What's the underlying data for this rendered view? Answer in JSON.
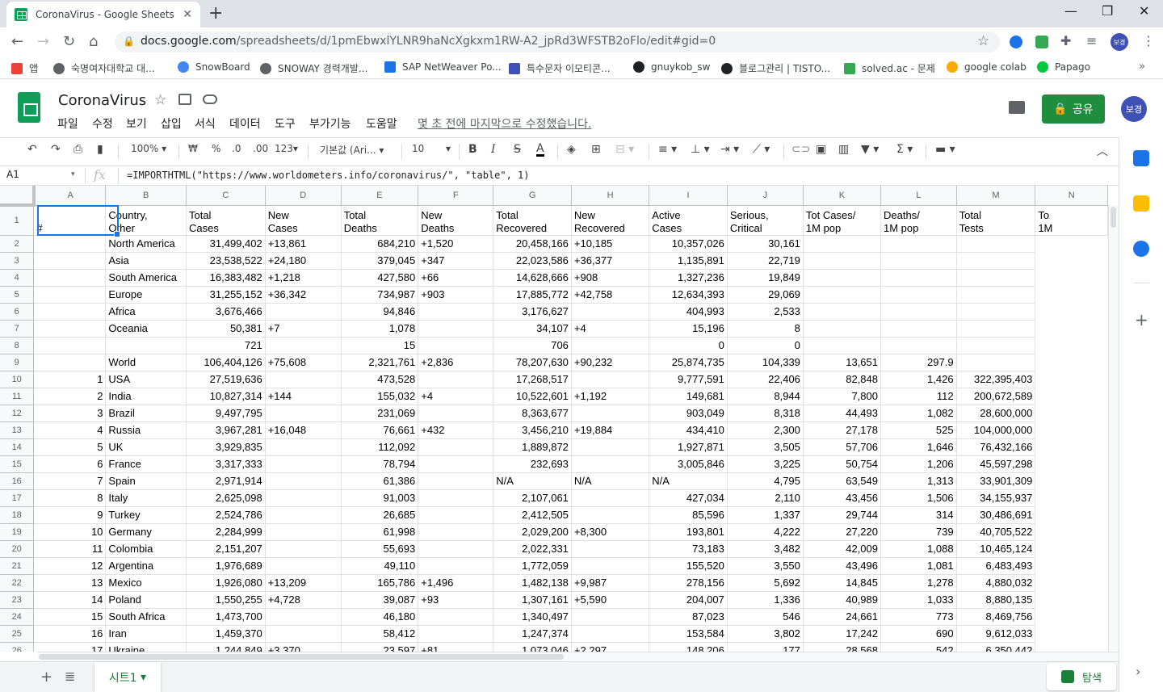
{
  "browser": {
    "tab_title": "CoronaVirus - Google Sheets",
    "new_tab": "+",
    "close": "✕",
    "url_host": "docs.google.com",
    "url_path": "/spreadsheets/d/1pmEbwxlYLNR9haNcXgkxm1RW-A2_jpRd3WFSTB2oFlo/edit#gid=0",
    "avatar": "보경"
  },
  "bookmarks": [
    {
      "label": "앱",
      "color": "#ea4335"
    },
    {
      "label": "숙명여자대학교 대...",
      "color": "#5f6368"
    },
    {
      "label": "SnowBoard",
      "color": "#4285f4"
    },
    {
      "label": "SNOWAY 경력개발...",
      "color": "#5f6368"
    },
    {
      "label": "SAP NetWeaver Po...",
      "color": "#1a73e8"
    },
    {
      "label": "특수문자 이모티콘...",
      "color": "#3f51b5"
    },
    {
      "label": "gnuykob_sw",
      "color": "#202124"
    },
    {
      "label": "블로그관리 | TISTO...",
      "color": "#202124"
    },
    {
      "label": "solved.ac - 문제",
      "color": "#34a853"
    },
    {
      "label": "google colab",
      "color": "#f9ab00"
    },
    {
      "label": "Papago",
      "color": "#00c73c"
    }
  ],
  "doc": {
    "title": "CoronaVirus",
    "menus": [
      "파일",
      "수정",
      "보기",
      "삽입",
      "서식",
      "데이터",
      "도구",
      "부가기능",
      "도움말"
    ],
    "last_edit": "몇 초 전에 마지막으로 수정했습니다.",
    "share": "공유"
  },
  "toolbar": {
    "zoom": "100%",
    "currency": "₩",
    "percent": "%",
    "dec_less": ".0",
    "dec_more": ".00",
    "format": "123",
    "font": "기본값 (Ari...",
    "size": "10",
    "bold": "B",
    "italic": "I",
    "strike": "S",
    "textcolor": "A"
  },
  "formula_bar": {
    "namebox": "A1",
    "fx": "fx",
    "formula": "=IMPORTHTML(\"https://www.worldometers.info/coronavirus/\", \"table\", 1)"
  },
  "columns": [
    "A",
    "B",
    "C",
    "D",
    "E",
    "F",
    "G",
    "H",
    "I",
    "J",
    "K",
    "L",
    "M",
    "N"
  ],
  "header_row": [
    "#",
    "Country,\nOther",
    "Total\nCases",
    "New\nCases",
    "Total\nDeaths",
    "New\nDeaths",
    "Total\nRecovered",
    "New\nRecovered",
    "Active\nCases",
    "Serious,\nCritical",
    "Tot Cases/\n1M pop",
    "Deaths/\n1M pop",
    "Total\nTests",
    "To\n1M"
  ],
  "rows": [
    [
      "2",
      "",
      "North America",
      "31,499,402",
      "+13,861",
      "684,210",
      "+1,520",
      "20,458,166",
      "+10,185",
      "10,357,026",
      "30,161",
      "",
      "",
      ""
    ],
    [
      "3",
      "",
      "Asia",
      "23,538,522",
      "+24,180",
      "379,045",
      "+347",
      "22,023,586",
      "+36,377",
      "1,135,891",
      "22,719",
      "",
      "",
      ""
    ],
    [
      "4",
      "",
      "South America",
      "16,383,482",
      "+1,218",
      "427,580",
      "+66",
      "14,628,666",
      "+908",
      "1,327,236",
      "19,849",
      "",
      "",
      ""
    ],
    [
      "5",
      "",
      "Europe",
      "31,255,152",
      "+36,342",
      "734,987",
      "+903",
      "17,885,772",
      "+42,758",
      "12,634,393",
      "29,069",
      "",
      "",
      ""
    ],
    [
      "6",
      "",
      "Africa",
      "3,676,466",
      "",
      "94,846",
      "",
      "3,176,627",
      "",
      "404,993",
      "2,533",
      "",
      "",
      ""
    ],
    [
      "7",
      "",
      "Oceania",
      "50,381",
      "+7",
      "1,078",
      "",
      "34,107",
      "+4",
      "15,196",
      "8",
      "",
      "",
      ""
    ],
    [
      "8",
      "",
      "",
      "721",
      "",
      "15",
      "",
      "706",
      "",
      "0",
      "0",
      "",
      "",
      ""
    ],
    [
      "9",
      "",
      "World",
      "106,404,126",
      "+75,608",
      "2,321,761",
      "+2,836",
      "78,207,630",
      "+90,232",
      "25,874,735",
      "104,339",
      "13,651",
      "297.9",
      ""
    ],
    [
      "10",
      "1",
      "USA",
      "27,519,636",
      "",
      "473,528",
      "",
      "17,268,517",
      "",
      "9,777,591",
      "22,406",
      "82,848",
      "1,426",
      "322,395,403"
    ],
    [
      "11",
      "2",
      "India",
      "10,827,314",
      "+144",
      "155,032",
      "+4",
      "10,522,601",
      "+1,192",
      "149,681",
      "8,944",
      "7,800",
      "112",
      "200,672,589"
    ],
    [
      "12",
      "3",
      "Brazil",
      "9,497,795",
      "",
      "231,069",
      "",
      "8,363,677",
      "",
      "903,049",
      "8,318",
      "44,493",
      "1,082",
      "28,600,000"
    ],
    [
      "13",
      "4",
      "Russia",
      "3,967,281",
      "+16,048",
      "76,661",
      "+432",
      "3,456,210",
      "+19,884",
      "434,410",
      "2,300",
      "27,178",
      "525",
      "104,000,000"
    ],
    [
      "14",
      "5",
      "UK",
      "3,929,835",
      "",
      "112,092",
      "",
      "1,889,872",
      "",
      "1,927,871",
      "3,505",
      "57,706",
      "1,646",
      "76,432,166"
    ],
    [
      "15",
      "6",
      "France",
      "3,317,333",
      "",
      "78,794",
      "",
      "232,693",
      "",
      "3,005,846",
      "3,225",
      "50,754",
      "1,206",
      "45,597,298"
    ],
    [
      "16",
      "7",
      "Spain",
      "2,971,914",
      "",
      "61,386",
      "",
      "N/A",
      "N/A",
      "N/A",
      "4,795",
      "63,549",
      "1,313",
      "33,901,309"
    ],
    [
      "17",
      "8",
      "Italy",
      "2,625,098",
      "",
      "91,003",
      "",
      "2,107,061",
      "",
      "427,034",
      "2,110",
      "43,456",
      "1,506",
      "34,155,937"
    ],
    [
      "18",
      "9",
      "Turkey",
      "2,524,786",
      "",
      "26,685",
      "",
      "2,412,505",
      "",
      "85,596",
      "1,337",
      "29,744",
      "314",
      "30,486,691"
    ],
    [
      "19",
      "10",
      "Germany",
      "2,284,999",
      "",
      "61,998",
      "",
      "2,029,200",
      "+8,300",
      "193,801",
      "4,222",
      "27,220",
      "739",
      "40,705,522"
    ],
    [
      "20",
      "11",
      "Colombia",
      "2,151,207",
      "",
      "55,693",
      "",
      "2,022,331",
      "",
      "73,183",
      "3,482",
      "42,009",
      "1,088",
      "10,465,124"
    ],
    [
      "21",
      "12",
      "Argentina",
      "1,976,689",
      "",
      "49,110",
      "",
      "1,772,059",
      "",
      "155,520",
      "3,550",
      "43,496",
      "1,081",
      "6,483,493"
    ],
    [
      "22",
      "13",
      "Mexico",
      "1,926,080",
      "+13,209",
      "165,786",
      "+1,496",
      "1,482,138",
      "+9,987",
      "278,156",
      "5,692",
      "14,845",
      "1,278",
      "4,880,032"
    ],
    [
      "23",
      "14",
      "Poland",
      "1,550,255",
      "+4,728",
      "39,087",
      "+93",
      "1,307,161",
      "+5,590",
      "204,007",
      "1,336",
      "40,989",
      "1,033",
      "8,880,135"
    ],
    [
      "24",
      "15",
      "South Africa",
      "1,473,700",
      "",
      "46,180",
      "",
      "1,340,497",
      "",
      "87,023",
      "546",
      "24,661",
      "773",
      "8,469,756"
    ],
    [
      "25",
      "16",
      "Iran",
      "1,459,370",
      "",
      "58,412",
      "",
      "1,247,374",
      "",
      "153,584",
      "3,802",
      "17,242",
      "690",
      "9,612,033"
    ],
    [
      "26",
      "17",
      "Ukraine",
      "1,244,849",
      "+3,370",
      "23,597",
      "+81",
      "1,073,046",
      "+2,297",
      "148,206",
      "177",
      "28,568",
      "542",
      "6,350,442"
    ]
  ],
  "sheet": {
    "tab": "시트1",
    "explore": "탐색"
  }
}
